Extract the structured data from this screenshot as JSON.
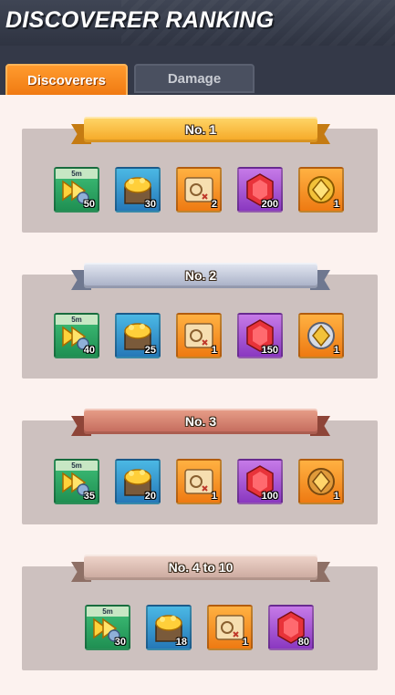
{
  "header": {
    "title": "DISCOVERER RANKING"
  },
  "tabs": [
    {
      "label": "Discoverers",
      "active": true
    },
    {
      "label": "Damage",
      "active": false
    }
  ],
  "colors": {
    "accent": "#f07a12",
    "header": "#343948"
  },
  "ranks": [
    {
      "label": "No. 1",
      "style": "gold",
      "rewards": [
        {
          "icon": "speedup-icon",
          "tag": "5m",
          "qty": "50"
        },
        {
          "icon": "gold-chest-icon",
          "qty": "30"
        },
        {
          "icon": "treasure-map-icon",
          "qty": "2"
        },
        {
          "icon": "ruby-gem-icon",
          "qty": "200"
        },
        {
          "icon": "golden-emblem-icon",
          "qty": "1"
        }
      ]
    },
    {
      "label": "No. 2",
      "style": "silver",
      "rewards": [
        {
          "icon": "speedup-icon",
          "tag": "5m",
          "qty": "40"
        },
        {
          "icon": "gold-chest-icon",
          "qty": "25"
        },
        {
          "icon": "treasure-map-icon",
          "qty": "1"
        },
        {
          "icon": "ruby-gem-icon",
          "qty": "150"
        },
        {
          "icon": "silver-emblem-icon",
          "qty": "1"
        }
      ]
    },
    {
      "label": "No. 3",
      "style": "bronze",
      "rewards": [
        {
          "icon": "speedup-icon",
          "tag": "5m",
          "qty": "35"
        },
        {
          "icon": "gold-chest-icon",
          "qty": "20"
        },
        {
          "icon": "treasure-map-icon",
          "qty": "1"
        },
        {
          "icon": "ruby-gem-icon",
          "qty": "100"
        },
        {
          "icon": "bronze-emblem-icon",
          "qty": "1"
        }
      ]
    },
    {
      "label": "No. 4 to 10",
      "style": "plain",
      "rewards": [
        {
          "icon": "speedup-icon",
          "tag": "5m",
          "qty": "30"
        },
        {
          "icon": "gold-chest-icon",
          "qty": "18"
        },
        {
          "icon": "treasure-map-icon",
          "qty": "1"
        },
        {
          "icon": "ruby-gem-icon",
          "qty": "80"
        }
      ]
    }
  ]
}
